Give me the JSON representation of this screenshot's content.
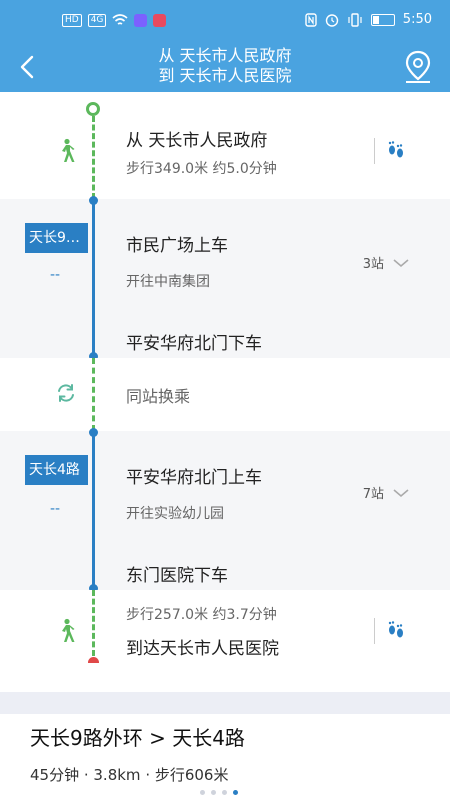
{
  "status_bar": {
    "left_chips": [
      "HD",
      "4G"
    ],
    "time": "5:50",
    "icons": [
      "nfc-icon",
      "alarm-icon",
      "vibrate-icon",
      "battery-icon"
    ]
  },
  "header": {
    "from_line": "从 天长市人民政府",
    "to_line": "到 天长市人民医院"
  },
  "steps": {
    "start": {
      "title": "从 天长市人民政府",
      "detail": "步行349.0米 约5.0分钟"
    },
    "bus1": {
      "tag": "天长9…",
      "dash": "--",
      "board": "市民广场上车",
      "direction": "开往中南集团",
      "stops": "3站",
      "alight": "平安华府北门下车"
    },
    "transfer": {
      "label": "同站换乘"
    },
    "bus2": {
      "tag": "天长4路",
      "dash": "--",
      "board": "平安华府北门上车",
      "direction": "开往实验幼儿园",
      "stops": "7站",
      "alight": "东门医院下车"
    },
    "end": {
      "detail": "步行257.0米 约3.7分钟",
      "title": "到达天长市人民医院"
    }
  },
  "summary": {
    "route": "天长9路外环 > 天长4路",
    "meta": "45分钟 · 3.8km · 步行606米",
    "pages": 4,
    "active_page": 3
  },
  "colors": {
    "header": "#4aa3e0",
    "bus_line": "#2a7fc4",
    "walk_line": "#5cb85c",
    "end_dot": "#e04848"
  }
}
